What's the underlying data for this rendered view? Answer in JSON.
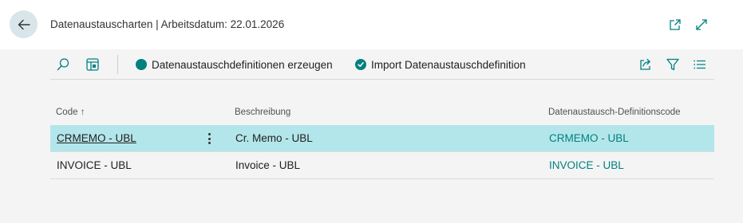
{
  "header": {
    "title": "Datenaustauscharten | Arbeitsdatum: 22.01.2026",
    "icons": [
      "back-arrow-icon",
      "open-new-window-icon",
      "expand-icon"
    ]
  },
  "toolbar": {
    "icons": [
      "search-icon",
      "view-layout-icon",
      "share-icon",
      "filter-icon",
      "list-view-icon"
    ],
    "actions": [
      {
        "label": "Datenaustauschdefinitionen erzeugen",
        "icon": "circle-icon"
      },
      {
        "label": "Import Datenaustauschdefinition",
        "icon": "check-circle-icon"
      }
    ]
  },
  "grid": {
    "columns": [
      {
        "label": "Code",
        "sort_indicator": "↑"
      },
      {
        "label": "Beschreibung"
      },
      {
        "label": "Datenaustausch-Definitionscode"
      }
    ],
    "rows": [
      {
        "code": "CRMEMO - UBL",
        "description": "Cr. Memo - UBL",
        "definition_code": "CRMEMO - UBL",
        "selected": true
      },
      {
        "code": "INVOICE - UBL",
        "description": "Invoice - UBL",
        "definition_code": "INVOICE - UBL",
        "selected": false
      }
    ]
  },
  "colors": {
    "accent": "#00807f",
    "selected_row": "#b3e6ea",
    "back_button_bg": "#d8e6ea"
  }
}
